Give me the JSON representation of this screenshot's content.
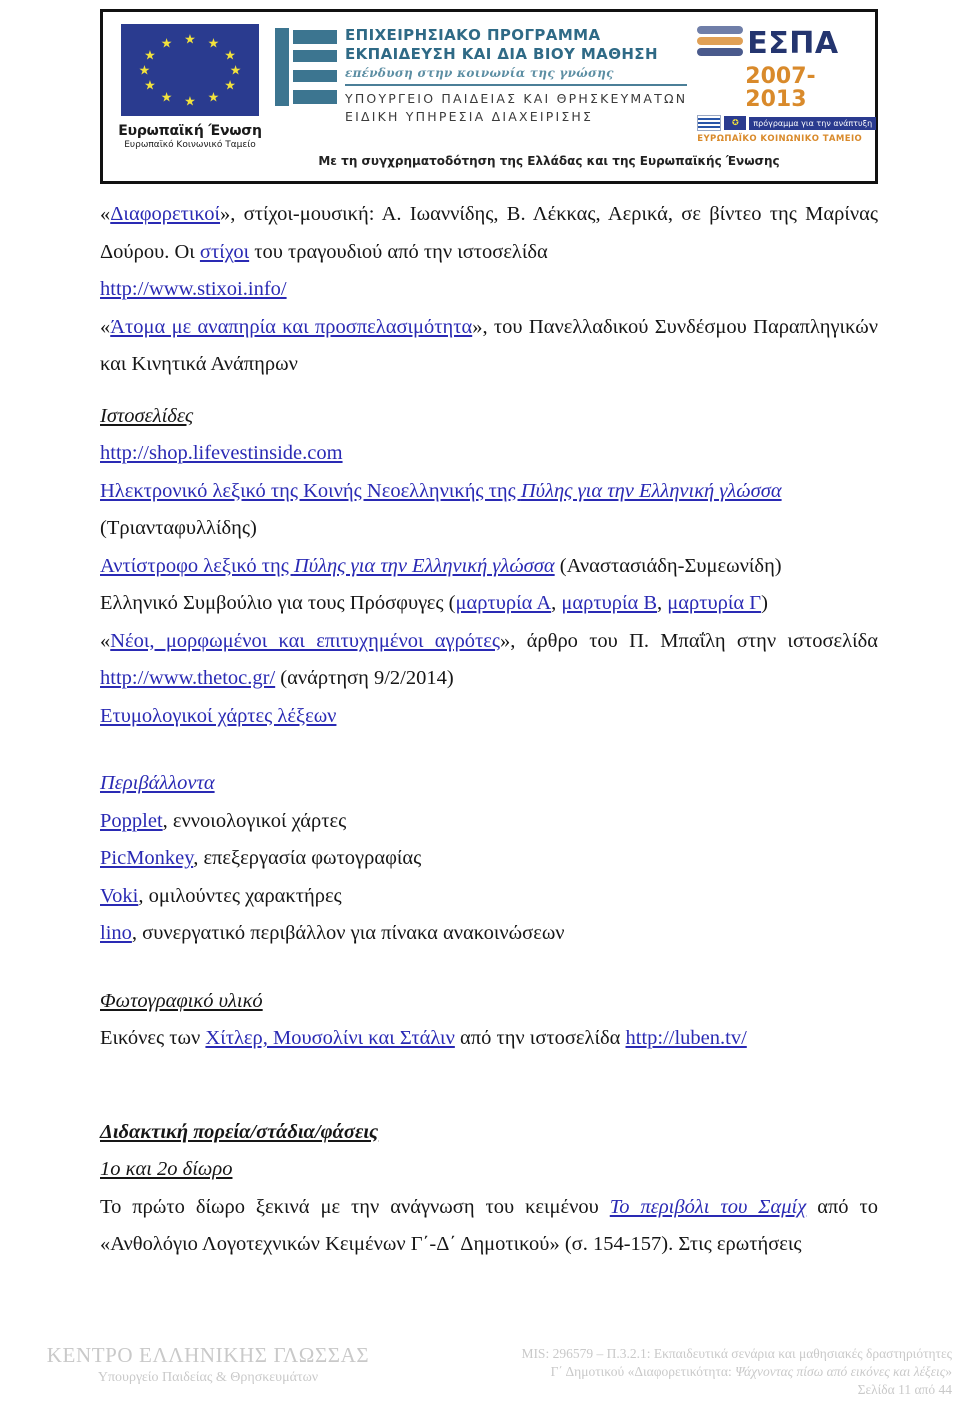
{
  "header_banner": {
    "eu": {
      "flag_name": "european-union-flag",
      "caption_bold": "Ευρωπαϊκή Ένωση",
      "caption_small": "Ευρωπαϊκό Κοινωνικό Ταμείο"
    },
    "ministry": {
      "line1": "ΕΠΙΧΕΙΡΗΣΙΑΚΟ ΠΡΟΓΡΑΜΜΑ",
      "line2": "ΕΚΠΑΙΔΕΥΣΗ ΚΑΙ ΔΙΑ ΒΙΟΥ ΜΑΘΗΣΗ",
      "line3": "επένδυση στην κοινωνία της γνώσης",
      "line4": "ΥΠΟΥΡΓΕΙΟ ΠΑΙΔΕΙΑΣ ΚΑΙ ΘΡΗΣΚΕΥΜΑΤΩΝ",
      "line5": "ΕΙΔΙΚΗ ΥΠΗΡΕΣΙΑ ΔΙΑΧΕΙΡΙΣΗΣ"
    },
    "espa": {
      "word": "ΕΣΠΑ",
      "years": "2007-2013",
      "tag": "πρόγραμμα για την ανάπτυξη",
      "foot": "ΕΥΡΩΠΑΪΚΟ ΚΟΙΝΩΝΙΚΟ ΤΑΜΕΙΟ"
    },
    "bottom_line": "Με τη συγχρηματοδότηση της Ελλάδας και της Ευρωπαϊκής Ένωσης"
  },
  "body": {
    "p1": {
      "open_quote": "«",
      "link1": "Διαφορετικοί",
      "after1": "», στίχοι-μουσική: Α. Ιωαννίδης, Β. Λέκκας, Αερικά, σε βίντεο της Μαρίνας Δούρου. Οι ",
      "link2": "στίχοι",
      "after2": " του τραγουδιού από την ιστοσελίδα"
    },
    "p2_link": "http://www.stixoi.info/",
    "p3": {
      "open_quote": "«",
      "link": "Άτομα με αναπηρία και προσπελασιμότητα",
      "after": "», του Πανελλαδικού Συνδέσμου Παραπληγικών και Κινητικά Ανάπηρων"
    },
    "h_istoselides": "Ιστοσελίδες",
    "p4_link": "http://shop.lifevestinside.com",
    "p5": {
      "part_a": "Ηλεκτρονικό λεξικό της Κοινής Νεοελληνικής της ",
      "part_b_italic": "Πύλης για την Ελληνική γλώσσα",
      "after": "(Τριανταφυλλίδης)"
    },
    "p6": {
      "part_a": "Αντίστροφο λεξικό της ",
      "part_b_italic": "Πύλης για την Ελληνική γλώσσα",
      "after": " (Αναστασιάδη-Συμεωνίδη)"
    },
    "p7": {
      "before": "Ελληνικό Συμβούλιο για τους Πρόσφυγες (",
      "link1": "μαρτυρία Α",
      "sep1": ", ",
      "link2": "μαρτυρία Β",
      "sep2": ", ",
      "link3": "μαρτυρία Γ",
      "after": ")"
    },
    "p8": {
      "open_quote": "«",
      "link": "Νέοι, μορφωμένοι και επιτυχημένοι αγρότες",
      "mid": "», άρθρο του Π. Μπαΐλη στην ιστοσελίδα ",
      "link2": "http://www.thetoc.gr/",
      "after": " (ανάρτηση 9/2/2014)"
    },
    "p9_link": "Ετυμολογικοί χάρτες λέξεων",
    "h_perivallonta": "Περιβάλλοντα",
    "tools": [
      {
        "link": "Popplet",
        "desc": ", εννοιολογικοί χάρτες"
      },
      {
        "link": "PicMonkey",
        "desc": ", επεξεργασία φωτογραφίας"
      },
      {
        "link": "Voki",
        "desc": ", ομιλούντες χαρακτήρες"
      },
      {
        "link": "lino",
        "desc": ", συνεργατικό περιβάλλον για πίνακα ανακοινώσεων"
      }
    ],
    "h_fotografiko": "Φωτογραφικό υλικό",
    "p10": {
      "before": "Εικόνες των ",
      "link1": "Χίτλερ, Μουσολίνι και Στάλιν",
      "mid": " από την ιστοσελίδα ",
      "link2": "http://luben.tv/"
    },
    "h_didaktiki": "Διδακτική πορεία/στάδια/φάσεις",
    "h_diwro": "1ο και 2ο δίωρο",
    "p11": {
      "before": "Το πρώτο δίωρο ξεκινά με την ανάγνωση του κειμένου ",
      "link": "Το περιβόλι του Σαμίχ",
      "after": " από το «Ανθολόγιο Λογοτεχνικών Κειμένων Γ΄-Δ΄ Δημοτικού» (σ. 154-157). Στις ερωτήσεις"
    }
  },
  "footer": {
    "left_line1": "ΚΕΝΤΡΟ ΕΛΛΗΝΙΚΗΣ ΓΛΩΣΣΑΣ",
    "left_line2": "Υπουργείο Παιδείας & Θρησκευμάτων",
    "right_line1": "MIS: 296579 – Π.3.2.1: Εκπαιδευτικά σενάρια και μαθησιακές δραστηριότητες",
    "right_line2_a": "Γ΄ Δημοτικού «Διαφορετικότητα: ",
    "right_line2_b": "Ψάχνοντας πίσω από εικόνες και λέξεις",
    "right_line2_c": "»",
    "right_line3": "Σελίδα 11 από 44"
  },
  "colors": {
    "link": "#2a2ab4",
    "text": "#161616",
    "footer_gray": "#c9c9c9",
    "eu_blue": "#2a3b8f",
    "espa_blue": "#24356f",
    "espa_orange": "#d98a2b",
    "teal": "#3c7590"
  }
}
